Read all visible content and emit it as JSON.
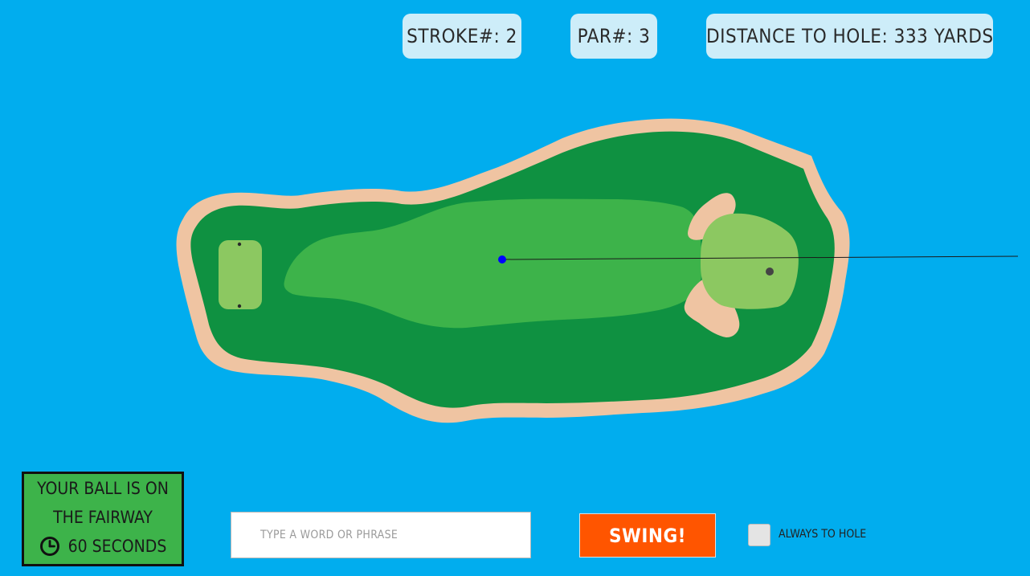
{
  "header": {
    "stroke_label": "STROKE#: 2",
    "par_label": "PAR#: 3",
    "distance_label": "DISTANCE TO HOLE: 333 YARDS"
  },
  "status": {
    "line1": "YOUR BALL IS ON",
    "line2": "THE FAIRWAY",
    "timer_text": "60 SECONDS"
  },
  "controls": {
    "input_value": "",
    "input_placeholder": "TYPE A WORD OR PHRASE",
    "swing_label": "SWING!",
    "always_to_hole_label": "ALWAYS TO HOLE",
    "always_to_hole_checked": false
  },
  "colors": {
    "water": "#01adee",
    "sand": "#efc4a2",
    "rough": "#0f9141",
    "fairway": "#3db34a",
    "green": "#8cc861",
    "ball": "#0000ff",
    "hole": "#444444",
    "swing_button": "#ff5500"
  }
}
